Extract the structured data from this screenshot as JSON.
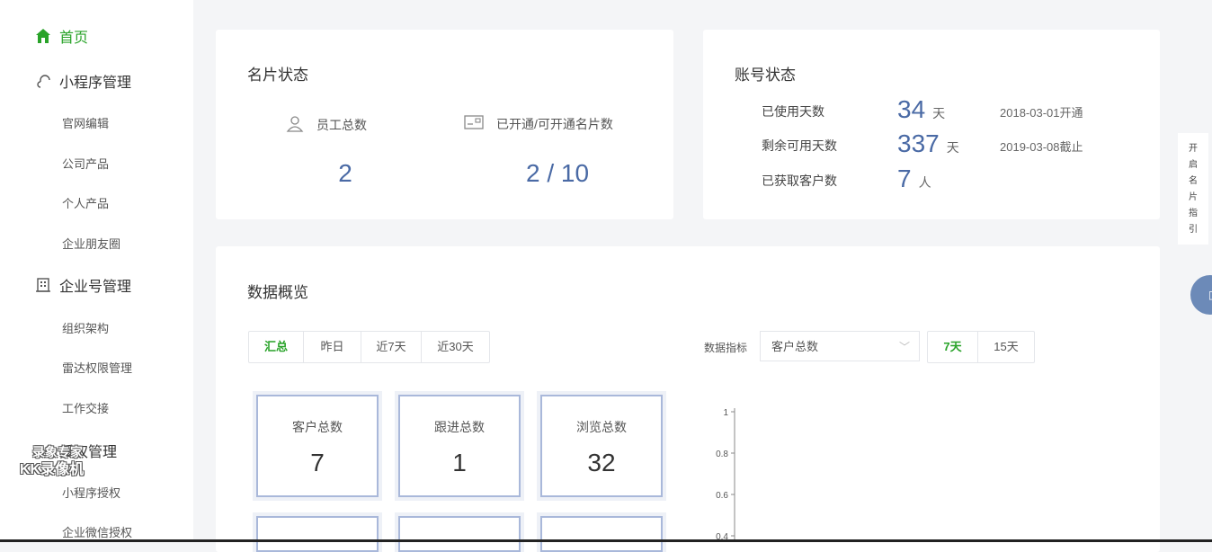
{
  "sidebar": {
    "home": "首页",
    "miniprogram": {
      "label": "小程序管理",
      "items": [
        "官网编辑",
        "公司产品",
        "个人产品",
        "企业朋友圈"
      ]
    },
    "enterprise": {
      "label": "企业号管理",
      "items": [
        "组织架构",
        "雷达权限管理",
        "工作交接"
      ]
    },
    "auth": {
      "label": "授权管理",
      "items": [
        "小程序授权",
        "企业微信授权"
      ]
    },
    "watermark": [
      "录象专家",
      "KK录像机"
    ]
  },
  "card_status": {
    "title": "名片状态",
    "employees_label": "员工总数",
    "employees_value": "2",
    "cards_label": "已开通/可开通名片数",
    "cards_value": "2 / 10"
  },
  "account_status": {
    "title": "账号状态",
    "rows": [
      {
        "label": "已使用天数",
        "value": "34",
        "unit": "天",
        "date": "2018-03-01开通"
      },
      {
        "label": "剩余可用天数",
        "value": "337",
        "unit": "天",
        "date": "2019-03-08截止"
      },
      {
        "label": "已获取客户数",
        "value": "7",
        "unit": "人",
        "date": ""
      }
    ]
  },
  "overview": {
    "title": "数据概览",
    "tabs": [
      "汇总",
      "昨日",
      "近7天",
      "近30天"
    ],
    "active_tab": 0,
    "metric_label": "数据指标",
    "metric_selected": "客户总数",
    "range_tabs": [
      "7天",
      "15天"
    ],
    "active_range": 0,
    "boxes": [
      {
        "label": "客户总数",
        "value": "7"
      },
      {
        "label": "跟进总数",
        "value": "1"
      },
      {
        "label": "浏览总数",
        "value": "32"
      }
    ]
  },
  "guide": [
    "开",
    "启",
    "名",
    "片",
    "指",
    "引"
  ],
  "chart_data": {
    "type": "line",
    "title": "",
    "xlabel": "",
    "ylabel": "",
    "y_ticks": [
      "1",
      "0.8",
      "0.6",
      "0.4"
    ],
    "ylim": [
      0,
      1
    ],
    "series": []
  },
  "colors": {
    "accent_green": "#29a329",
    "value_blue": "#4a6aa5",
    "box_border": "#a9b8da"
  }
}
